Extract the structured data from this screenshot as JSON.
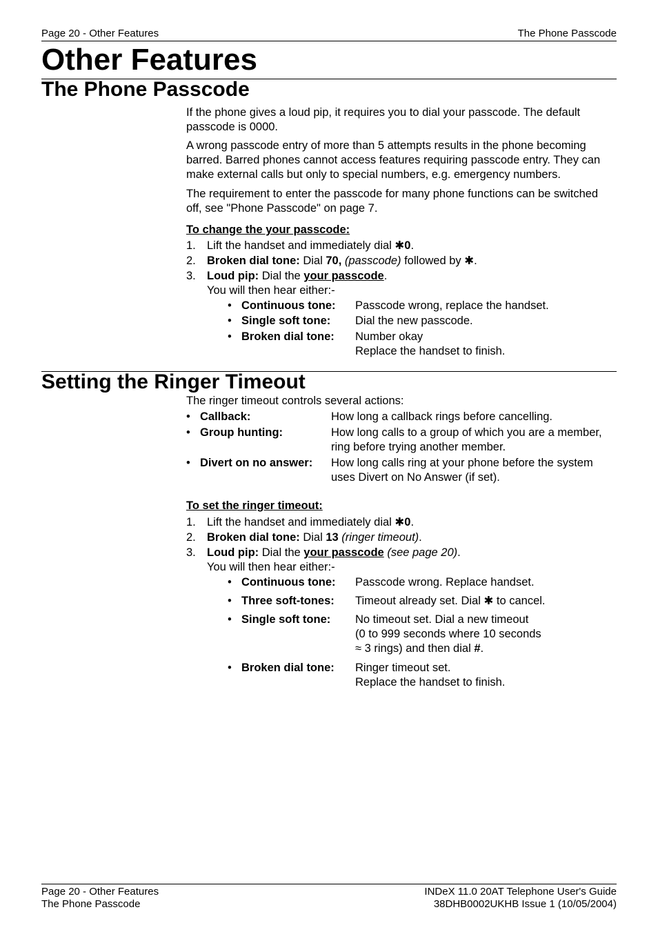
{
  "header": {
    "left": "Page 20 - Other Features",
    "right": "The Phone Passcode"
  },
  "title": "Other Features",
  "s1": {
    "heading": "The Phone Passcode",
    "p1": "If the phone gives a loud pip, it requires you to dial your passcode.  The default passcode is 0000.",
    "p2": "A wrong passcode entry of more than 5 attempts results in the phone becoming barred. Barred phones cannot access features requiring passcode entry. They can make external calls but only to special numbers, e.g. emergency numbers.",
    "p3": "The requirement to enter the passcode for many phone functions can be switched off, see \"Phone Passcode\" on page 7.",
    "sub_ul": "To change the your passcode",
    "sub_colon": ":",
    "li1a": "Lift the handset and immediately dial ",
    "li1b": "✱",
    "li1c": "0",
    "li1d": ".",
    "li2a": "Broken dial tone:",
    "li2b": " Dial ",
    "li2c": "70, ",
    "li2d": "(passcode)",
    "li2e": " followed by ",
    "li2f": "✱",
    "li2g": ".",
    "li3a": "Loud pip:",
    "li3b": " Dial the ",
    "li3c": "your passcode",
    "li3d": ".",
    "li3e": "You will then hear either:-",
    "b1l": "Continuous tone:",
    "b1d": "Passcode wrong, replace the handset.",
    "b2l": "Single soft tone:",
    "b2d": "Dial the new passcode.",
    "b3l": "Broken dial tone:",
    "b3d1": "Number okay",
    "b3d2": "Replace the handset to finish."
  },
  "s2": {
    "heading": "Setting the Ringer Timeout",
    "intro": "The ringer timeout controls several actions:",
    "r1l": "Callback:",
    "r1d": "How long a callback rings before cancelling.",
    "r2l": "Group hunting:",
    "r2d": "How long calls to a group of which you are a member, ring before trying another member.",
    "r3l": "Divert on no answer:",
    "r3d": "How long calls ring at your phone before the system uses Divert on No Answer (if set).",
    "sub_ul": "To set the ringer timeout",
    "sub_colon": ":",
    "li1a": "Lift the handset and immediately dial ",
    "li1b": "✱",
    "li1c": "0",
    "li1d": ".",
    "li2a": "Broken dial tone:",
    "li2b": " Dial ",
    "li2c": "13 ",
    "li2d": "(ringer timeout)",
    "li2e": ".",
    "li3a": "Loud pip:",
    "li3b": " Dial the ",
    "li3c": "your passcode",
    "li3d": " (see page 20)",
    "li3e": ".",
    "li3f": "You will then hear either:-",
    "b1l": "Continuous tone:",
    "b1d": "Passcode wrong. Replace handset.",
    "b2l": "Three soft-tones:",
    "b2da": "Timeout already set. Dial ",
    "b2db": "✱",
    "b2dc": " to cancel.",
    "b3l": "Single soft tone:",
    "b3d1": "No timeout set. Dial a new timeout",
    "b3d2": "(0 to 999 seconds where 10 seconds",
    "b3d3a": "≈ 3 rings) and then dial ",
    "b3d3b": "#",
    "b3d3c": ".",
    "b4l": "Broken dial tone:",
    "b4d1": "Ringer timeout set.",
    "b4d2": "Replace the handset to finish."
  },
  "footer": {
    "l1": "Page 20 - Other Features",
    "l2": "The Phone Passcode",
    "r1": "INDeX 11.0 20AT Telephone User's Guide",
    "r2": "38DHB0002UKHB Issue 1 (10/05/2004)"
  },
  "bullet": "•",
  "n1": "1.",
  "n2": "2.",
  "n3": "3."
}
